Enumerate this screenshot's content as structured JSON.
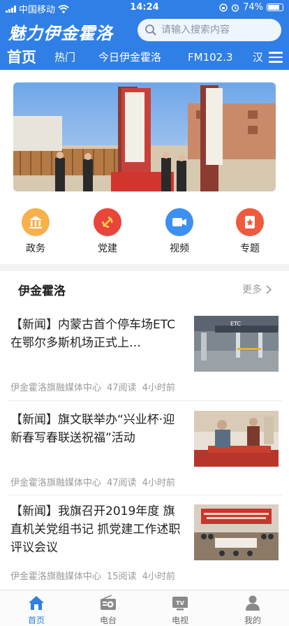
{
  "status_bar": {
    "carrier": "中国移动",
    "time": "14:24",
    "battery": "74%"
  },
  "header": {
    "brand": "魅力伊金霍洛",
    "search_placeholder": "请输入搜索内容",
    "accent_color": "#2f7fe6"
  },
  "tabs": [
    "首页",
    "热门",
    "今日伊金霍洛",
    "FM102.3",
    "汉语"
  ],
  "active_tab": "首页",
  "quick_links": [
    {
      "label": "政务",
      "icon": "government-icon",
      "color": "#f5a623"
    },
    {
      "label": "党建",
      "icon": "party-emblem-icon",
      "color": "#e8453c"
    },
    {
      "label": "视频",
      "icon": "video-camera-icon",
      "color": "#3d8ff0"
    },
    {
      "label": "专题",
      "icon": "topic-icon",
      "color": "#ef5a3c"
    }
  ],
  "section": {
    "title": "伊金霍洛",
    "more_label": "更多"
  },
  "news": [
    {
      "title": "【新闻】内蒙古首个停车场ETC在鄂尔多斯机场正式上…",
      "source": "伊金霍洛旗融媒体中心",
      "reads": "47阅读",
      "time": "4小时前",
      "thumb_text": "ETC"
    },
    {
      "title": "【新闻】旗文联举办“兴业杯·迎新春写春联送祝福”活动",
      "source": "伊金霍洛旗融媒体中心",
      "reads": "47阅读",
      "time": "4小时前",
      "thumb_text": ""
    },
    {
      "title": "【新闻】我旗召开2019年度 旗直机关党组书记 抓党建工作述职评议会议",
      "source": "伊金霍洛旗融媒体中心",
      "reads": "15阅读",
      "time": "4小时前",
      "thumb_text": ""
    }
  ],
  "bottom_nav": [
    {
      "label": "首页",
      "icon": "home-icon",
      "active": true
    },
    {
      "label": "电台",
      "icon": "radio-icon",
      "active": false
    },
    {
      "label": "电视",
      "icon": "tv-icon",
      "active": false
    },
    {
      "label": "我的",
      "icon": "profile-icon",
      "active": false
    }
  ]
}
